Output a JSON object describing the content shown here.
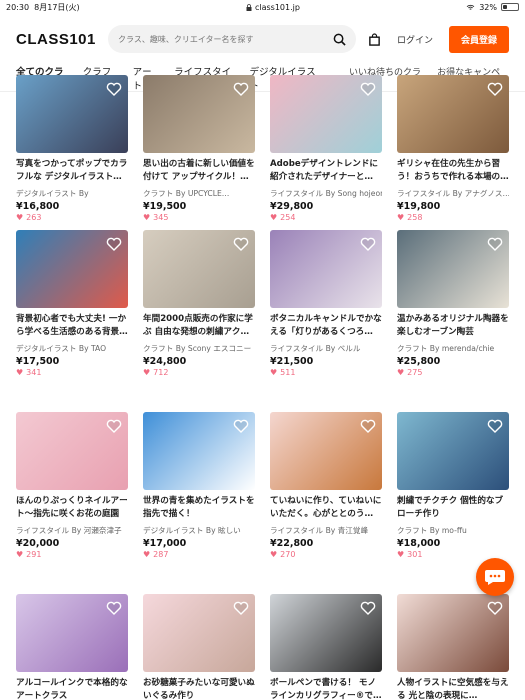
{
  "statusbar": {
    "time": "20:30",
    "date": "8月17日(火)",
    "url": "class101.jp",
    "battery": "32%",
    "battery_level": 0.32
  },
  "header": {
    "logo": "CLASS101",
    "search_placeholder": "クラス、趣味、クリエイター名を探す",
    "login": "ログイン",
    "signup": "会員登録"
  },
  "nav": {
    "tabs": [
      "全てのクラス",
      "クラフト",
      "アート",
      "ライフスタイル",
      "デジタルイラスト"
    ],
    "right_tabs": [
      "いいね待ちのクラス",
      "お得なキャンペーン"
    ]
  },
  "cards": [
    {
      "title": "写真をつかってポップでカラフルな デジタルイラスト…",
      "meta": "デジタルイラスト By",
      "price": "¥16,800",
      "likes": "263",
      "colors": [
        "#6aa0c8",
        "#3a3f58"
      ]
    },
    {
      "title": "思い出の古着に新しい価値を付けて アップサイクル！…",
      "meta": "クラフト By UPCYCLE…",
      "price": "¥19,500",
      "likes": "345",
      "colors": [
        "#8b7b6a",
        "#c9b8a0"
      ]
    },
    {
      "title": "Adobeデザイントレンドに紹介されたデザイナーと…",
      "meta": "ライフスタイル By Song hojeong",
      "price": "¥29,800",
      "likes": "254",
      "colors": [
        "#f0b7c4",
        "#9fd0d8"
      ]
    },
    {
      "title": "ギリシャ在住の先生から習う！おうちで作れる本場の…",
      "meta": "ライフスタイル By アナグノス…",
      "price": "¥19,800",
      "likes": "258",
      "colors": [
        "#c8a57c",
        "#7d5a3c"
      ]
    },
    {
      "title": "背景初心者でも大丈夫! 一から学べる生活感のある背景…",
      "meta": "デジタルイラスト By TAO",
      "price": "¥17,500",
      "likes": "341",
      "colors": [
        "#2f7fb8",
        "#e05a4a"
      ]
    },
    {
      "title": "年間2000点販売の作家に学ぶ 自由な発想の刺繍アク…",
      "meta": "クラフト By Scony エスコニー",
      "price": "¥24,800",
      "likes": "712",
      "colors": [
        "#d6cdbf",
        "#a89f91"
      ]
    },
    {
      "title": "ボタニカルキャンドルでかなえる「灯りがあるくつろ…",
      "meta": "ライフスタイル By ベルル",
      "price": "¥21,500",
      "likes": "511",
      "colors": [
        "#9a82b8",
        "#e9e3ea"
      ]
    },
    {
      "title": "温かみあるオリジナル陶器を楽しむオーブン陶芸",
      "meta": "クラフト By merenda/chie",
      "price": "¥25,800",
      "likes": "275",
      "colors": [
        "#5a6e7a",
        "#e8e2d6"
      ]
    },
    {
      "title": "ほんのりぷっくりネイルアート〜指先に咲くお花の庭園",
      "meta": "ライフスタイル By 河瀬奈津子",
      "price": "¥20,000",
      "likes": "291",
      "colors": [
        "#f3c9d2",
        "#e8a0b0"
      ]
    },
    {
      "title": "世界の青を集めたイラストを指先で描く！",
      "meta": "デジタルイラスト By 眩しい",
      "price": "¥17,000",
      "likes": "287",
      "colors": [
        "#3f8fd8",
        "#ffffff"
      ]
    },
    {
      "title": "ていねいに作り、ていねいにいただく。心がととのう…",
      "meta": "ライフスタイル By 青江覚峰",
      "price": "¥22,800",
      "likes": "270",
      "colors": [
        "#f4d6cf",
        "#c8783c"
      ]
    },
    {
      "title": "刺繍でチクチク 個性的なブローチ作り",
      "meta": "クラフト By mo-ffu",
      "price": "¥18,000",
      "likes": "301",
      "colors": [
        "#7fb8d0",
        "#2c4f7a"
      ]
    },
    {
      "title": "アルコールインクで本格的なアートクラス",
      "meta": "",
      "price": "",
      "likes": "",
      "colors": [
        "#d8c6e8",
        "#9a6fb8"
      ]
    },
    {
      "title": "お砂糖菓子みたいな可愛いぬいぐるみ作り",
      "meta": "",
      "price": "",
      "likes": "",
      "colors": [
        "#f5d8dc",
        "#c7a79a"
      ]
    },
    {
      "title": "ボールペンで書ける！ モノラインカリグラフィー®で…",
      "meta": "",
      "price": "",
      "likes": "",
      "colors": [
        "#d0d4d8",
        "#2a2a2a"
      ]
    },
    {
      "title": "人物イラストに空気感を与える 光と陰の表現に…",
      "meta": "",
      "price": "",
      "likes": "",
      "colors": [
        "#f1dcd6",
        "#7a4a3a"
      ]
    }
  ]
}
